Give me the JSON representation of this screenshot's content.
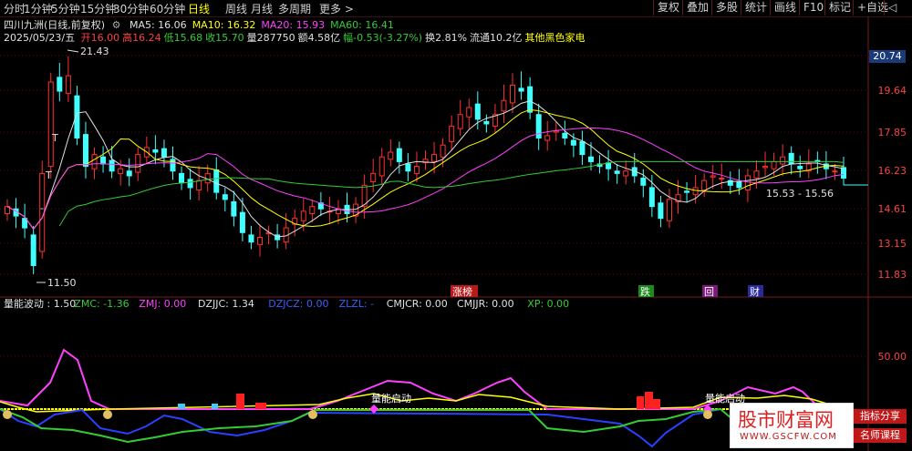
{
  "toolbar": {
    "periods": [
      "分时",
      "1分钟",
      "5分钟",
      "15分钟",
      "30分钟",
      "60分钟",
      "日线",
      "周线",
      "月线",
      "多周期",
      "更多 >"
    ],
    "active_period": "日线",
    "right_buttons": [
      "复权",
      "叠加",
      "多股",
      "统计",
      "画线",
      "F10",
      "标记",
      "+自选",
      "◁"
    ]
  },
  "header": {
    "stock_name": "四川九洲(日线,前复权)",
    "ma_items": [
      {
        "label": "MA5: 16.06",
        "color": "#e0e0e0"
      },
      {
        "label": "MA10: 16.32",
        "color": "#ffff00"
      },
      {
        "label": "MA20: 15.93",
        "color": "#ff40ff"
      },
      {
        "label": "MA60: 16.41",
        "color": "#33cc33"
      }
    ],
    "quote_date": "2025/05/23/五",
    "quote_items": [
      {
        "label": "开16.00",
        "color": "#ff4040"
      },
      {
        "label": "高16.24",
        "color": "#ff4040"
      },
      {
        "label": "低15.68",
        "color": "#33cc33"
      },
      {
        "label": "收15.70",
        "color": "#33cc33"
      },
      {
        "label": "量287750",
        "color": "#e0e0e0"
      },
      {
        "label": "额4.58亿",
        "color": "#e0e0e0"
      },
      {
        "label": "幅-0.53(-3.27%)",
        "color": "#33cc33"
      },
      {
        "label": "换2.81%",
        "color": "#e0e0e0"
      },
      {
        "label": "流通10.2亿",
        "color": "#e0e0e0"
      },
      {
        "label": "其他黑色家电",
        "color": "#ffff00"
      }
    ]
  },
  "chart_data": [
    {
      "type": "candlestick",
      "title": "四川九洲(日线,前复权)",
      "y_ticks": [
        "20.74",
        "19.64",
        "17.85",
        "16.23",
        "14.61",
        "13.15",
        "11.83"
      ],
      "current_price_label": "20.74",
      "annotations": [
        "21.43",
        "11.50",
        "15.53 - 15.56",
        "T",
        "T",
        "-"
      ],
      "events": [
        "涨榜",
        "跌",
        "回",
        "财"
      ],
      "series": [
        {
          "name": "MA5",
          "color": "#e0e0e0"
        },
        {
          "name": "MA10",
          "color": "#ffff00"
        },
        {
          "name": "MA20",
          "color": "#ff40ff"
        },
        {
          "name": "MA60",
          "color": "#33cc33"
        }
      ]
    },
    {
      "type": "line",
      "title": "量能波动",
      "legend": [
        {
          "label": "量能波动 : 1.50",
          "color": "#e0e0e0"
        },
        {
          "label": "ZMC: -1.36",
          "color": "#33cc33"
        },
        {
          "label": "ZMJ: 0.00",
          "color": "#ff40ff"
        },
        {
          "label": "DZJJC: 1.34",
          "color": "#e0e0e0"
        },
        {
          "label": "DZJCZ: 0.00",
          "color": "#3a5fff"
        },
        {
          "label": "ZLZL: -",
          "color": "#3a5fff"
        },
        {
          "label": "CMJCR: 0.00",
          "color": "#e0e0e0"
        },
        {
          "label": "CMJJR: 0.00",
          "color": "#e0e0e0"
        },
        {
          "label": "XP: 0.00",
          "color": "#33cc33"
        }
      ],
      "y_ticks": [
        "50.00"
      ],
      "labels": [
        "量能启动",
        "量能启动"
      ]
    }
  ],
  "watermark": {
    "line1": "股市财富网",
    "line2": "WWW.GSCFW.COM",
    "tag1": "指标分享",
    "tag2": "名师课程"
  }
}
